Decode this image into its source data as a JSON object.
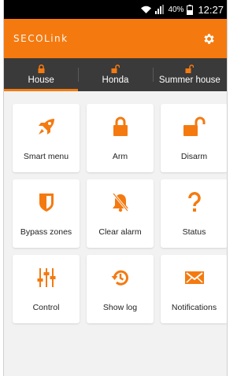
{
  "status_bar": {
    "battery_percent": "40%",
    "time": "12:27",
    "icons": [
      "wifi-icon",
      "signal-icon",
      "battery-icon"
    ]
  },
  "app_bar": {
    "logo_text": "SECOLink",
    "settings_icon": "gear-icon"
  },
  "tabs": [
    {
      "label": "House",
      "icon": "lock-closed-icon",
      "active": true
    },
    {
      "label": "Honda",
      "icon": "lock-open-icon",
      "active": false
    },
    {
      "label": "Summer house",
      "icon": "lock-open-icon",
      "active": false
    }
  ],
  "tiles": [
    {
      "label": "Smart menu",
      "icon": "rocket-icon"
    },
    {
      "label": "Arm",
      "icon": "lock-closed-icon"
    },
    {
      "label": "Disarm",
      "icon": "lock-open-icon"
    },
    {
      "label": "Bypass zones",
      "icon": "shield-icon"
    },
    {
      "label": "Clear alarm",
      "icon": "bell-off-icon"
    },
    {
      "label": "Status",
      "icon": "question-icon"
    },
    {
      "label": "Control",
      "icon": "sliders-icon"
    },
    {
      "label": "Show log",
      "icon": "history-icon"
    },
    {
      "label": "Notifications",
      "icon": "envelope-icon"
    }
  ],
  "colors": {
    "accent": "#f47a10",
    "tab_bar": "#3a3a3a",
    "background": "#f2f2f2"
  }
}
